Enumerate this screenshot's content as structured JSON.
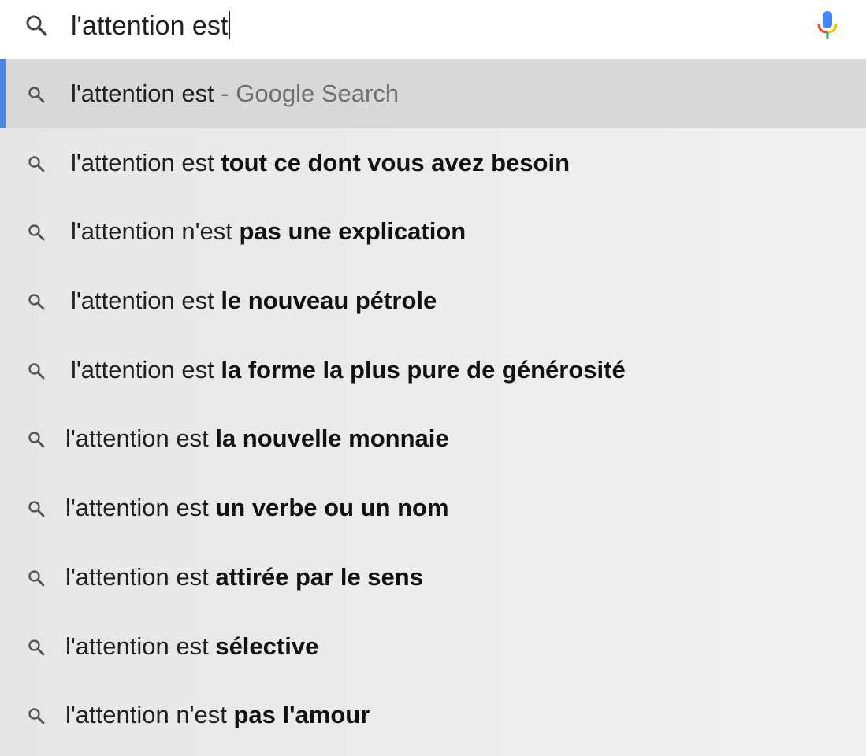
{
  "search": {
    "query": "l'attention est",
    "icon": "search-icon",
    "voice_icon": "mic-icon"
  },
  "colors": {
    "highlight_bar": "#4a86e8",
    "highlight_bg": "#d8d8da",
    "text": "#202020",
    "muted": "#6f6f6f"
  },
  "suggestions": [
    {
      "prefix": "l'attention est",
      "suffix": "- Google Search",
      "style": "muted"
    },
    {
      "prefix": "l'attention est",
      "suffix": "tout ce dont vous avez besoin",
      "style": "bold"
    },
    {
      "prefix": "l'attention n'est",
      "suffix": "pas une explication",
      "style": "bold"
    },
    {
      "prefix": "l'attention est",
      "suffix": "le nouveau pétrole",
      "style": "bold"
    },
    {
      "prefix": "l'attention est",
      "suffix": "la forme la plus pure de générosité",
      "style": "bold"
    },
    {
      "prefix": "l'attention est",
      "suffix": "la nouvelle monnaie",
      "style": "bold"
    },
    {
      "prefix": "l'attention est",
      "suffix": "un verbe ou un nom",
      "style": "bold"
    },
    {
      "prefix": "l'attention est",
      "suffix": "attirée par le sens",
      "style": "bold"
    },
    {
      "prefix": "l'attention est",
      "suffix": "sélective",
      "style": "bold"
    },
    {
      "prefix": "l'attention n'est",
      "suffix": "pas l'amour",
      "style": "bold"
    }
  ]
}
